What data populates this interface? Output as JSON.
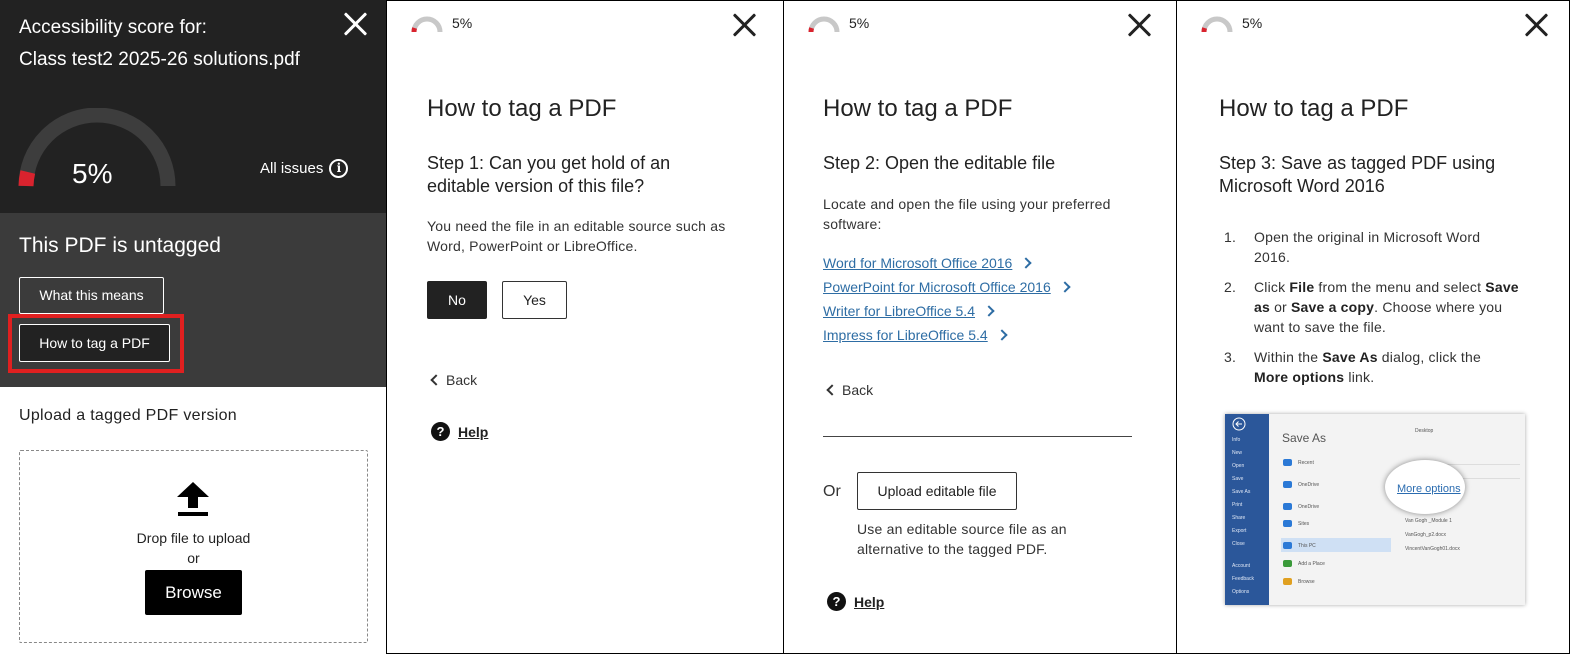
{
  "panel1": {
    "title": "Accessibility score for:",
    "filename": "Class test2 2025-26 solutions.pdf",
    "score": "5%",
    "all_issues_label": "All issues",
    "status_heading": "This PDF is untagged",
    "what_button": "What this means",
    "howto_button": "How to tag a PDF",
    "upload_title": "Upload a tagged PDF version",
    "drop_text": "Drop file to upload",
    "or_text": "or",
    "browse_button": "Browse"
  },
  "panel2": {
    "score": "5%",
    "heading": "How to tag a PDF",
    "step": "Step 1: Can you get hold of an editable version of this file?",
    "body": "You need the file in an editable source such as Word, PowerPoint or LibreOffice.",
    "no_button": "No",
    "yes_button": "Yes",
    "back_label": "Back",
    "help_label": "Help"
  },
  "panel3": {
    "score": "5%",
    "heading": "How to tag a PDF",
    "step": "Step 2: Open the editable file",
    "body": "Locate and open the file using your preferred software:",
    "links": [
      "Word for Microsoft Office 2016",
      "PowerPoint for Microsoft Office 2016",
      "Writer for LibreOffice 5.4",
      "Impress for LibreOffice 5.4"
    ],
    "back_label": "Back",
    "or_label": "Or",
    "upload_button": "Upload editable file",
    "upload_note": "Use an editable source file as an alternative to the tagged PDF.",
    "help_label": "Help"
  },
  "panel4": {
    "score": "5%",
    "heading": "How to tag a PDF",
    "step": "Step 3: Save as tagged PDF using Microsoft Word 2016",
    "steps": [
      {
        "pre": "Open the original in Microsoft Word 2016.",
        "b1": "",
        "mid": "",
        "b2": "",
        "post": ""
      },
      {
        "pre": "Click ",
        "b1": "File",
        "mid": " from the menu and select ",
        "b2": "Save as",
        "post": " or "
      },
      {
        "pre": "Within the ",
        "b1": "Save As",
        "mid": " dialog, click the ",
        "b2": "More options",
        "post": " link."
      }
    ],
    "step2_b3": "Save a copy",
    "step2_tail": ". Choose where you want to save the file.",
    "screenshot": {
      "title": "Save As",
      "more_options": "More options",
      "side": [
        "Info",
        "New",
        "Open",
        "Save",
        "Save As",
        "Print",
        "Share",
        "Export",
        "Close",
        "Account",
        "Feedback",
        "Options"
      ],
      "places": [
        "Recent",
        "OneDrive",
        "OneDrive",
        "Sites",
        "This PC",
        "Add a Place",
        "Browse"
      ],
      "desktop": "Desktop",
      "files": [
        "Van Gogh _Module 1",
        "VanGogh_p2.docx",
        "VincentVanGogh01.docx"
      ]
    }
  },
  "colors": {
    "gauge_red": "#d9232e",
    "link_blue": "#2e6da4",
    "highlight_red": "#e02020"
  }
}
